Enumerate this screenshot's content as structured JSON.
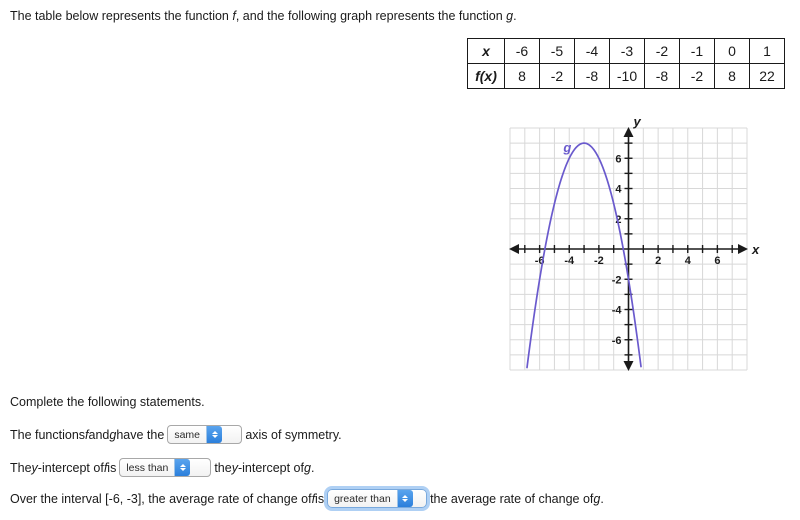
{
  "prompt": {
    "part1": "The table below represents the function ",
    "f": "f",
    "part2": ", and the following graph represents the function ",
    "g": "g",
    "part3": "."
  },
  "table": {
    "row_headers": [
      "x",
      "f(x)"
    ],
    "x_values": [
      "-6",
      "-5",
      "-4",
      "-3",
      "-2",
      "-1",
      "0",
      "1"
    ],
    "fx_values": [
      "8",
      "-2",
      "-8",
      "-10",
      "-8",
      "-2",
      "8",
      "22"
    ]
  },
  "graph": {
    "curve_label": "g",
    "x_axis_label": "x",
    "y_axis_label": "y",
    "x_tick_labels": [
      "-6",
      "-4",
      "-2",
      "2",
      "4",
      "6"
    ],
    "y_tick_labels": [
      "6",
      "4",
      "2",
      "-2",
      "-4",
      "-6"
    ],
    "curve_color": "#6A5ACD",
    "grid_color": "#d6d6d6",
    "axis_color": "#1a1a1a"
  },
  "chart_data": {
    "type": "line",
    "title": "",
    "xlabel": "x",
    "ylabel": "y",
    "xlim": [
      -8,
      8
    ],
    "ylim": [
      -8,
      8
    ],
    "grid": true,
    "legend": "none",
    "xticks": [
      -6,
      -4,
      -2,
      2,
      4,
      6
    ],
    "yticks": [
      6,
      4,
      2,
      -2,
      -4,
      -6
    ],
    "annotations": [
      {
        "text": "g",
        "x": -4.4,
        "y": 6.4
      }
    ],
    "series": [
      {
        "name": "g",
        "equation": "g(x) = -(x + 3)^2 + 7",
        "vertex": [
          -3,
          7
        ],
        "y_intercept": -2,
        "x_intercepts": [
          -5.65,
          -0.35
        ],
        "color": "#6A5ACD",
        "x": [
          -6.0,
          -5.5,
          -5.0,
          -4.5,
          -4.0,
          -3.5,
          -3.0,
          -2.5,
          -2.0,
          -1.5,
          -1.0,
          -0.5,
          0.0,
          0.5,
          1.0,
          1.5
        ],
        "y": [
          -2.0,
          0.75,
          3.0,
          4.75,
          6.0,
          6.75,
          7.0,
          6.75,
          6.0,
          4.75,
          3.0,
          0.75,
          -2.0,
          -5.25,
          -9.0,
          -13.25
        ]
      }
    ],
    "table_series": {
      "name": "f",
      "x": [
        -6,
        -5,
        -4,
        -3,
        -2,
        -1,
        0,
        1
      ],
      "y": [
        8,
        -2,
        -8,
        -10,
        -8,
        -2,
        8,
        22
      ]
    }
  },
  "statements": {
    "heading": "Complete the following statements.",
    "symmetry": {
      "before": "The functions ",
      "f": "f",
      "and": " and ",
      "g": "g",
      "mid": " have the",
      "select_value": "same",
      "after": "axis of symmetry."
    },
    "y_intercept": {
      "before": "The ",
      "y": "y",
      "mid1": "-intercept of ",
      "f": "f",
      "mid2": " is",
      "select_value": "less than",
      "after1": "the ",
      "y2": "y",
      "after2": "-intercept of ",
      "g": "g",
      "after3": "."
    },
    "rate_of_change": {
      "before": "Over the interval [-6, -3], the average rate of change of ",
      "f": "f",
      "mid": " is",
      "select_value": "greater than",
      "after": "the average rate of change of ",
      "g": "g",
      "after2": "."
    }
  }
}
